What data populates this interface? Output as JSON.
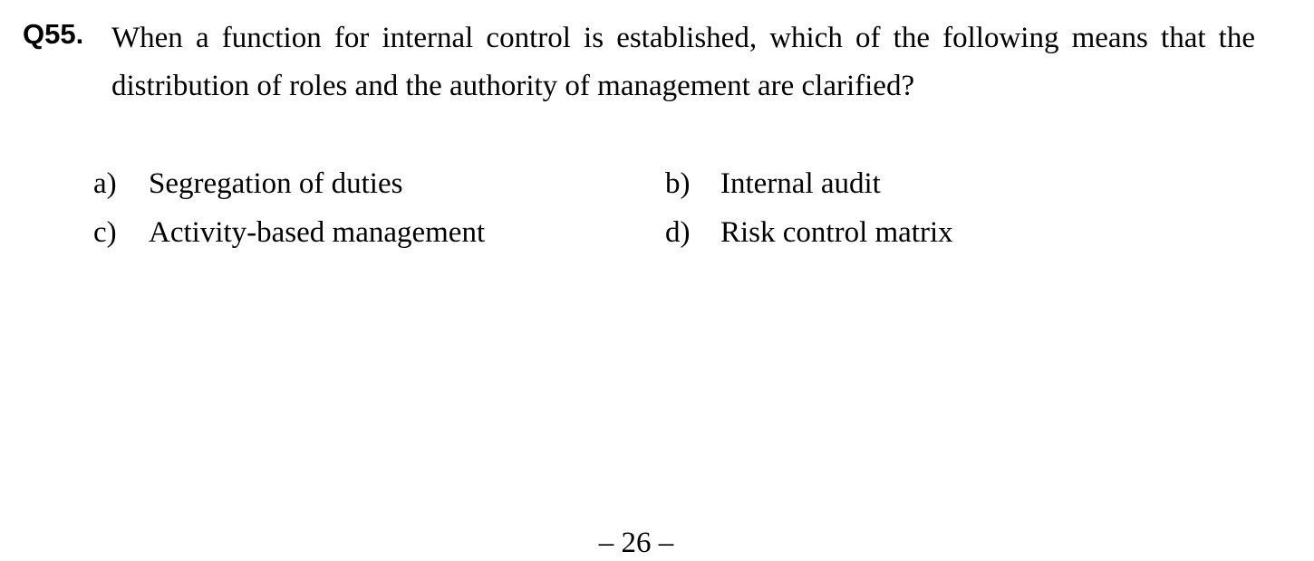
{
  "question": {
    "number": "Q55.",
    "text": "When a function for internal control is established, which of the following means that the distribution of roles and the authority of management are clarified?"
  },
  "choices": [
    {
      "letter": "a)",
      "text": "Segregation of duties"
    },
    {
      "letter": "b)",
      "text": "Internal audit"
    },
    {
      "letter": "c)",
      "text": "Activity-based management"
    },
    {
      "letter": "d)",
      "text": "Risk control matrix"
    }
  ],
  "footer": {
    "page_number": "– 26 –"
  }
}
